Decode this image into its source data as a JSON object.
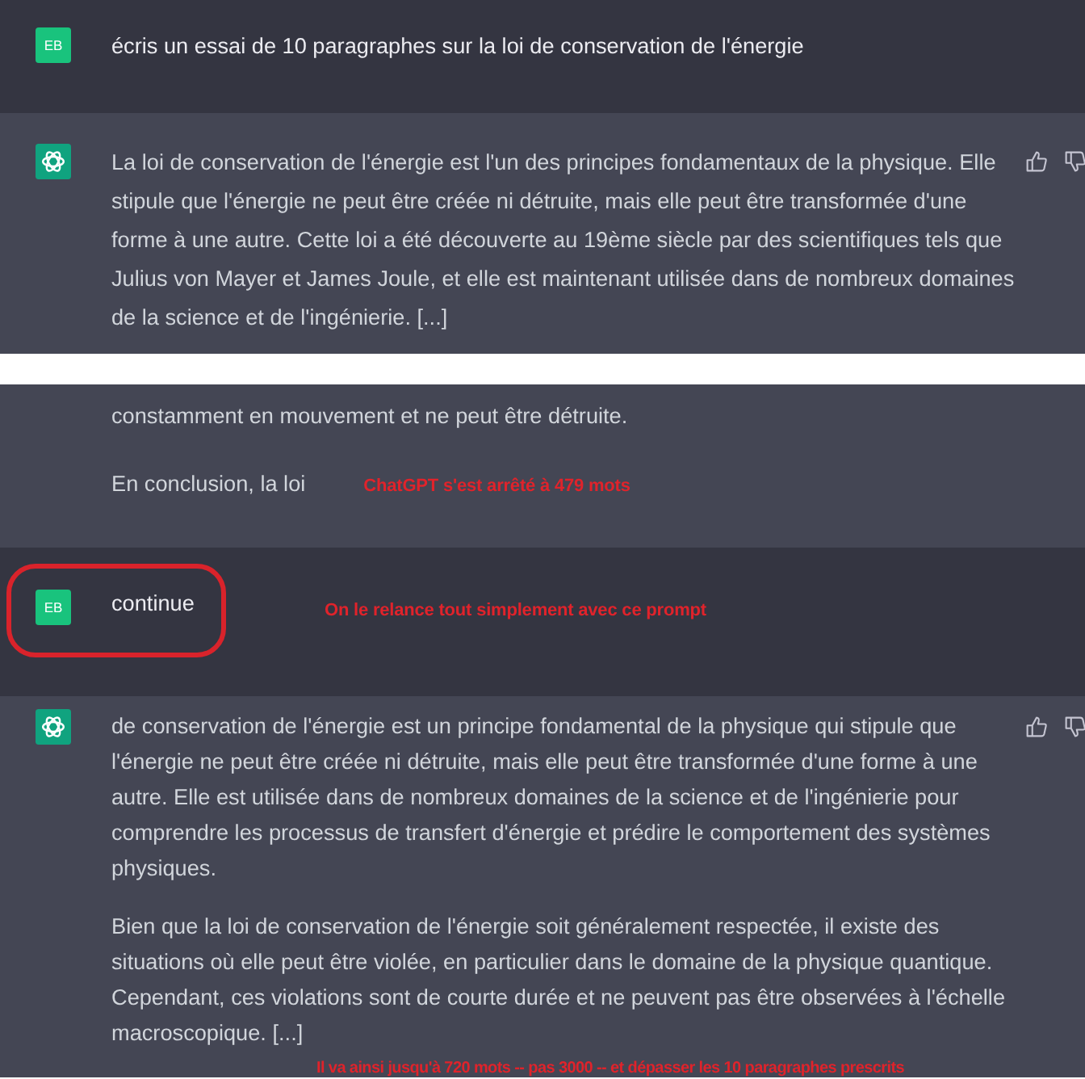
{
  "panels": [
    {
      "messages": [
        {
          "kind": "user",
          "avatar": "EB",
          "circled": false,
          "paragraphs": [
            "écris un essai de 10 paragraphes sur la loi de conservation de l'énergie"
          ]
        },
        {
          "kind": "assistant",
          "feedback": true,
          "paragraphs": [
            "La loi de conservation de l'énergie est l'un des principes fondamentaux de la physique. Elle stipule que l'énergie ne peut être créée ni détruite, mais elle peut être transformée d'une forme à une autre. Cette loi a été découverte au 19ème siècle par des scientifiques tels que Julius von Mayer et James Joule, et elle est maintenant utilisée dans de nombreux domaines de la science et de l'ingénierie. [...]"
          ]
        }
      ]
    },
    {
      "messages": [
        {
          "kind": "continuation",
          "paragraphs": [
            "constamment en mouvement et ne peut être détruite.",
            "En conclusion, la loi"
          ],
          "annotation": "ChatGPT s'est arrêté à 479 mots"
        },
        {
          "kind": "user",
          "avatar": "EB",
          "circled": true,
          "paragraphs": [
            "continue"
          ],
          "annotation": "On le relance tout simplement avec ce prompt"
        },
        {
          "kind": "assistant",
          "feedback": true,
          "paragraphs": [
            "de conservation de l'énergie est un principe fondamental de la physique qui stipule que l'énergie ne peut être créée ni détruite, mais elle peut être transformée d'une forme à une autre. Elle est utilisée dans de nombreux domaines de la science et de l'ingénierie pour comprendre les processus de transfert d'énergie et prédire le comportement des systèmes physiques.",
            "Bien que la loi de conservation de l'énergie soit généralement respectée, il existe des situations où elle peut être violée, en particulier dans le domaine de la physique quantique. Cependant, ces violations sont de courte durée et ne peuvent pas être observées à l'échelle macroscopique. [...]"
          ],
          "annotation": "Il va ainsi jusqu'à 720 mots -- pas 3000 -- et dépasser les 10 paragraphes prescrits"
        }
      ]
    }
  ]
}
